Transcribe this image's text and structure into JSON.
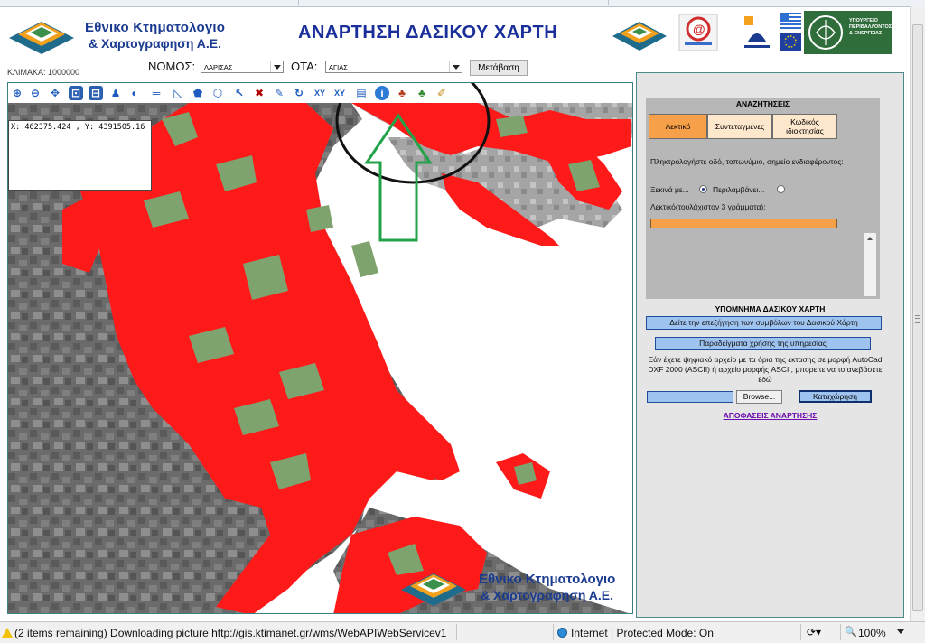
{
  "header": {
    "org_name_line1": "Εθνικο Κτηματολογιο",
    "org_name_line2": "& Χαρτογραφηση Α.Ε.",
    "title": "ΑΝΑΡΤΗΣΗ ΔΑΣΙΚΟΥ ΧΑΡΤΗ",
    "ministry_text": "ΥΠΟΥΡΓΕΙΟ ΠΕΡΙΒΑΛΛΟΝΤΟΣ & ΕΝΕΡΓΕΙΑΣ"
  },
  "controls": {
    "scale": "ΚΛΙΜΑΚΑ: 1000000",
    "nomos_label": "ΝΟΜΟΣ:",
    "nomos_value": "ΛΑΡΙΣΑΣ",
    "ota_label": "ΟΤΑ:",
    "ota_value": "ΑΓΙΑΣ",
    "go_button": "Μετάβαση"
  },
  "map": {
    "coordinates": "X: 462375.424 , Y: 4391505.16",
    "watermark_line1": "Εθνικο Κτηματολογιο",
    "watermark_line2": "& Χαρτογραφηση Α.Ε.",
    "tools": [
      "zoom-in",
      "zoom-out",
      "pan",
      "zoom-box",
      "zoom-extent",
      "select-user",
      "globe",
      "measure-line",
      "measure-angle",
      "polygon",
      "polygon-xy",
      "select",
      "clear",
      "edit",
      "refresh",
      "xy-point",
      "xy-goto",
      "layers",
      "info",
      "forest-info",
      "forest-tree",
      "broom"
    ]
  },
  "search": {
    "title": "ΑΝΑΖΗΤΗΣΕΙΣ",
    "tabs": [
      {
        "label": "Λεκτικό"
      },
      {
        "label": "Συντεταγμένες"
      },
      {
        "label": "Κωδικός ιδιοκτησίας"
      }
    ],
    "instructions": "Πληκτρολογήστε οδό, τοπωνύμιο, σημείο ενδιαφέροντος:",
    "option_starts": "Ξεκινά με...",
    "option_contains": "Περιλαμβάνει...",
    "min_chars_label": "Λεκτικό(τουλάχιστον 3 γράμματα):"
  },
  "legend": {
    "title": "ΥΠΟΜΝΗΜΑ ΔΑΣΙΚΟΥ ΧΑΡΤΗ",
    "symbols_button": "Δείτε την επεξήγηση των συμβόλων του Δασικού Χάρτη",
    "examples_button": "Παραδείγματα χρήσης της υπηρεσίας",
    "upload_text": "Εάν έχετε ψηφιακό αρχείο με τα όρια της έκτασης σε μορφή AutoCad DXF 2000 (ASCII) ή αρχείο μορφής ASCII, μπορείτε να το ανεβάσετε εδώ",
    "browse_button": "Browse...",
    "submit_button": "Καταχώρηση",
    "decisions_link": "ΑΠΟΦΑΣΕΙΣ ΑΝΑΡΤΗΣΗΣ"
  },
  "status": {
    "message": "(2 items remaining) Downloading picture http://gis.ktimanet.gr/wms/WebAPIWebServicev1",
    "zone": "Internet | Protected Mode: On",
    "zoom": "100%"
  },
  "colors": {
    "forest_red": "#ff1a1a",
    "forest_green": "#7ea36e",
    "brand_blue": "#1a3b8f",
    "tab_orange": "#f7a04a"
  }
}
